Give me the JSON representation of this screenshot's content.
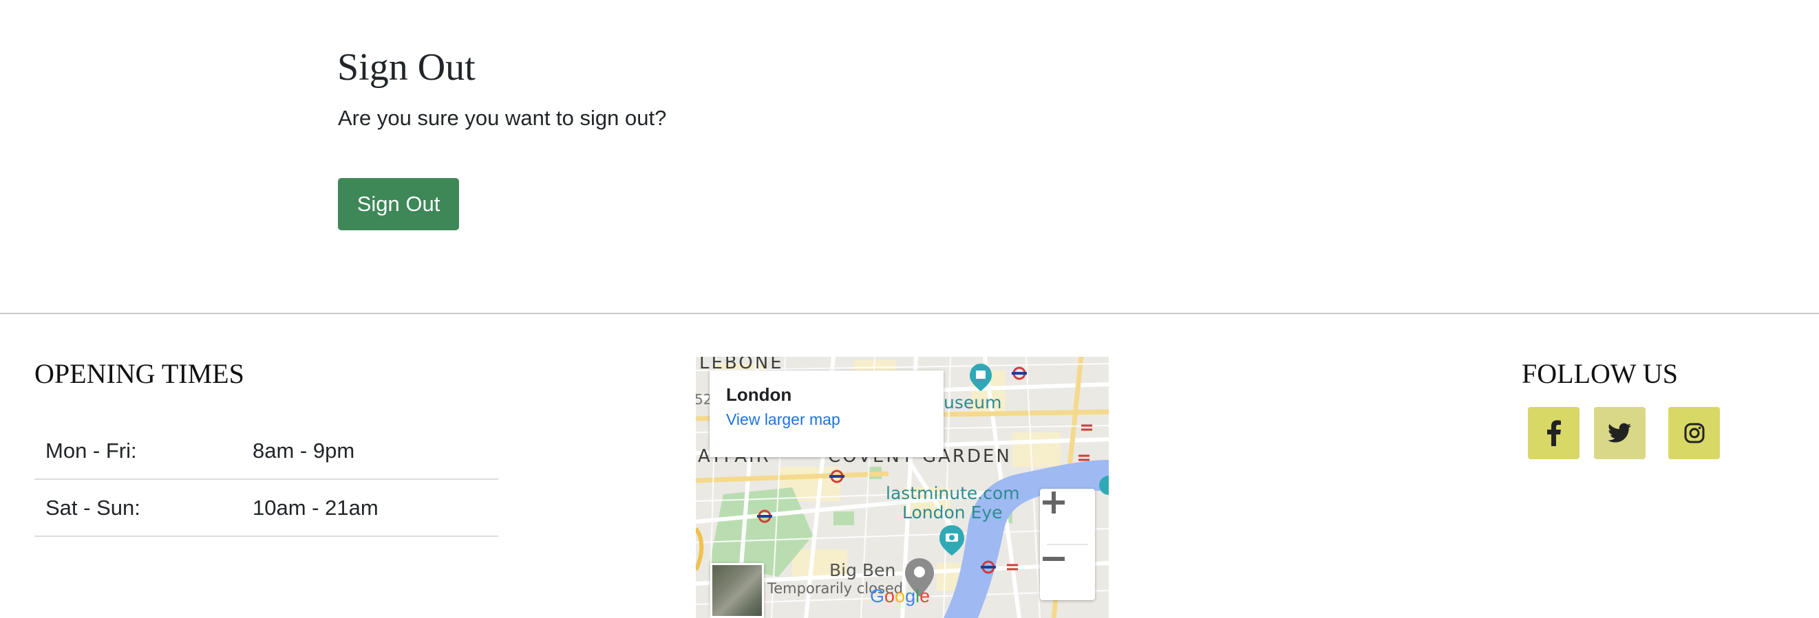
{
  "signout": {
    "title": "Sign Out",
    "message": "Are you sure you want to sign out?",
    "button_label": "Sign Out"
  },
  "footer": {
    "opening_times": {
      "heading": "OPENING TIMES",
      "rows": [
        {
          "day": "Mon - Fri:",
          "hours": "8am - 9pm"
        },
        {
          "day": "Sat - Sun:",
          "hours": "10am - 21am"
        }
      ]
    },
    "map": {
      "place_name": "London",
      "view_larger_link": "View larger map",
      "labels": {
        "marylebone": "LEBONE",
        "mayfair": "AYFAIR",
        "covent_garden": "COVENT GARDEN",
        "museum": "useum",
        "lastminute": "lastminute.com",
        "london_eye": "London Eye",
        "big_ben": "Big Ben",
        "temporarily_closed": "Temporarily closed",
        "edge_number": "52"
      },
      "logo_text": [
        "G",
        "o",
        "o",
        "g",
        "l",
        "e"
      ],
      "logo_colors": [
        "#4285F4",
        "#EA4335",
        "#FBBC05",
        "#4285F4",
        "#34A853",
        "#EA4335"
      ]
    },
    "follow_us": {
      "heading": "FOLLOW US",
      "buttons": [
        {
          "name": "facebook",
          "icon": "facebook-icon",
          "color": "#d8d867"
        },
        {
          "name": "twitter",
          "icon": "twitter-icon",
          "color": "#d9d886"
        },
        {
          "name": "instagram",
          "icon": "instagram-icon",
          "color": "#d8d867"
        }
      ]
    }
  },
  "colors": {
    "button_green": "#3e8757",
    "text": "#212529",
    "link_blue": "#1a73e8"
  }
}
